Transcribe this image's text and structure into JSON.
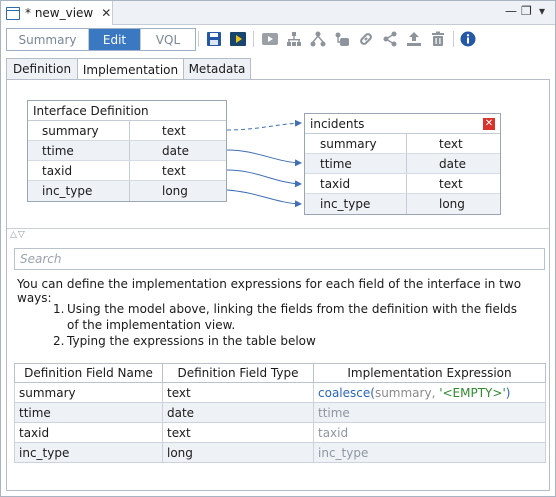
{
  "editor_tab": {
    "title": "* new_view",
    "close": "✕"
  },
  "window_controls": {
    "minimize": "—",
    "maximize": "❐",
    "menu": "▾"
  },
  "modes": {
    "summary": "Summary",
    "edit": "Edit",
    "vql": "VQL"
  },
  "toolbar_icons": [
    "save-icon",
    "run-icon",
    "preview-icon",
    "tree-icon",
    "hierarchy-icon",
    "tag-icon",
    "link-icon",
    "share-icon",
    "export-icon",
    "trash-icon",
    "info-icon"
  ],
  "subtabs": {
    "definition": "Definition",
    "implementation": "Implementation",
    "metadata": "Metadata"
  },
  "interface_entity": {
    "title": "Interface Definition",
    "rows": [
      {
        "name": "summary",
        "type": "text"
      },
      {
        "name": "ttime",
        "type": "date"
      },
      {
        "name": "taxid",
        "type": "text"
      },
      {
        "name": "inc_type",
        "type": "long"
      }
    ]
  },
  "impl_entity": {
    "title": "incidents",
    "rows": [
      {
        "name": "summary",
        "type": "text"
      },
      {
        "name": "ttime",
        "type": "date"
      },
      {
        "name": "taxid",
        "type": "text"
      },
      {
        "name": "inc_type",
        "type": "long"
      }
    ]
  },
  "search": {
    "placeholder": "Search"
  },
  "intro_text": "You can define the implementation expressions for each field of the interface in two ways:",
  "steps": [
    {
      "num": "1.",
      "text": "Using the model above, linking the fields from the definition with the fields of the implementation view."
    },
    {
      "num": "2.",
      "text": "Typing the expressions in the table below"
    }
  ],
  "table": {
    "headers": [
      "Definition Field Name",
      "Definition Field Type",
      "Implementation Expression"
    ],
    "rows": [
      {
        "name": "summary",
        "type": "text",
        "expr_fn": "coalesce",
        "expr_open": "(",
        "expr_arg": "summary",
        "expr_sep": ", ",
        "expr_str": "'<EMPTY>'",
        "expr_close": ")"
      },
      {
        "name": "ttime",
        "type": "date",
        "expr": "ttime"
      },
      {
        "name": "taxid",
        "type": "text",
        "expr": "taxid"
      },
      {
        "name": "inc_type",
        "type": "long",
        "expr": "inc_type"
      }
    ]
  },
  "colors": {
    "accent": "#3a78c2",
    "link_line": "#3f6fb5",
    "delete": "#d9342b"
  }
}
